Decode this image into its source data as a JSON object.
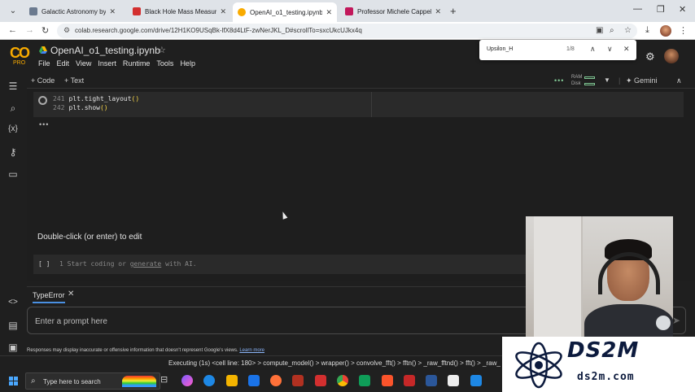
{
  "browser": {
    "tabs": [
      {
        "title": "Galactic Astronomy by Binney a",
        "color": "#6b7a8f",
        "active": false
      },
      {
        "title": "Black Hole Mass Measurement",
        "color": "#d32f2f",
        "active": false
      },
      {
        "title": "OpenAI_o1_testing.ipynb - Cola",
        "color": "#f9ab00",
        "active": true
      },
      {
        "title": "Professor Michele Cappellari H",
        "color": "#c2185b",
        "active": false
      }
    ],
    "url": "colab.research.google.com/drive/12H1KO9USqBk-lfX8d4LtF-zwNerJKL_D#scrollTo=sxcUkcUJkx4q"
  },
  "colab": {
    "logo": "CO",
    "plan": "PRO",
    "notebook_title": "OpenAI_o1_testing.ipynb",
    "menu": [
      "File",
      "Edit",
      "View",
      "Insert",
      "Runtime",
      "Tools",
      "Help"
    ],
    "toolbar": {
      "add_code": "+ Code",
      "add_text": "+ Text",
      "ram": "RAM",
      "disk": "Disk",
      "gemini": "Gemini"
    }
  },
  "find": {
    "query": "Upsilon_H",
    "count": "1/8"
  },
  "cells": {
    "code_lines": [
      {
        "num": "241",
        "code": "plt.tight_layout",
        "parens": "()"
      },
      {
        "num": "242",
        "code": "plt.show",
        "parens": "()"
      }
    ],
    "output_dots": "•••",
    "text_cell": "Double-click (or enter) to edit",
    "empty_cell": {
      "bracket": "[ ]",
      "line": "1",
      "text": "Start coding or ",
      "link": "generate",
      "tail": " with AI."
    }
  },
  "panel": {
    "tab": "TypeError",
    "prompt_placeholder": "Enter a prompt here",
    "disclaimer": "Responses may display inaccurate or offensive information that doesn't represent Google's views. ",
    "disclaimer_link": "Learn more"
  },
  "status": {
    "text": "Executing (1s)   <cell line: 180> > compute_model() > wrapper() > convolve_fft() > fftn() > _raw_fftnd() > fft() > _raw_"
  },
  "taskbar": {
    "search_placeholder": "Type here to search"
  },
  "brand": {
    "name": "DS2M",
    "site": "ds2m.com"
  }
}
